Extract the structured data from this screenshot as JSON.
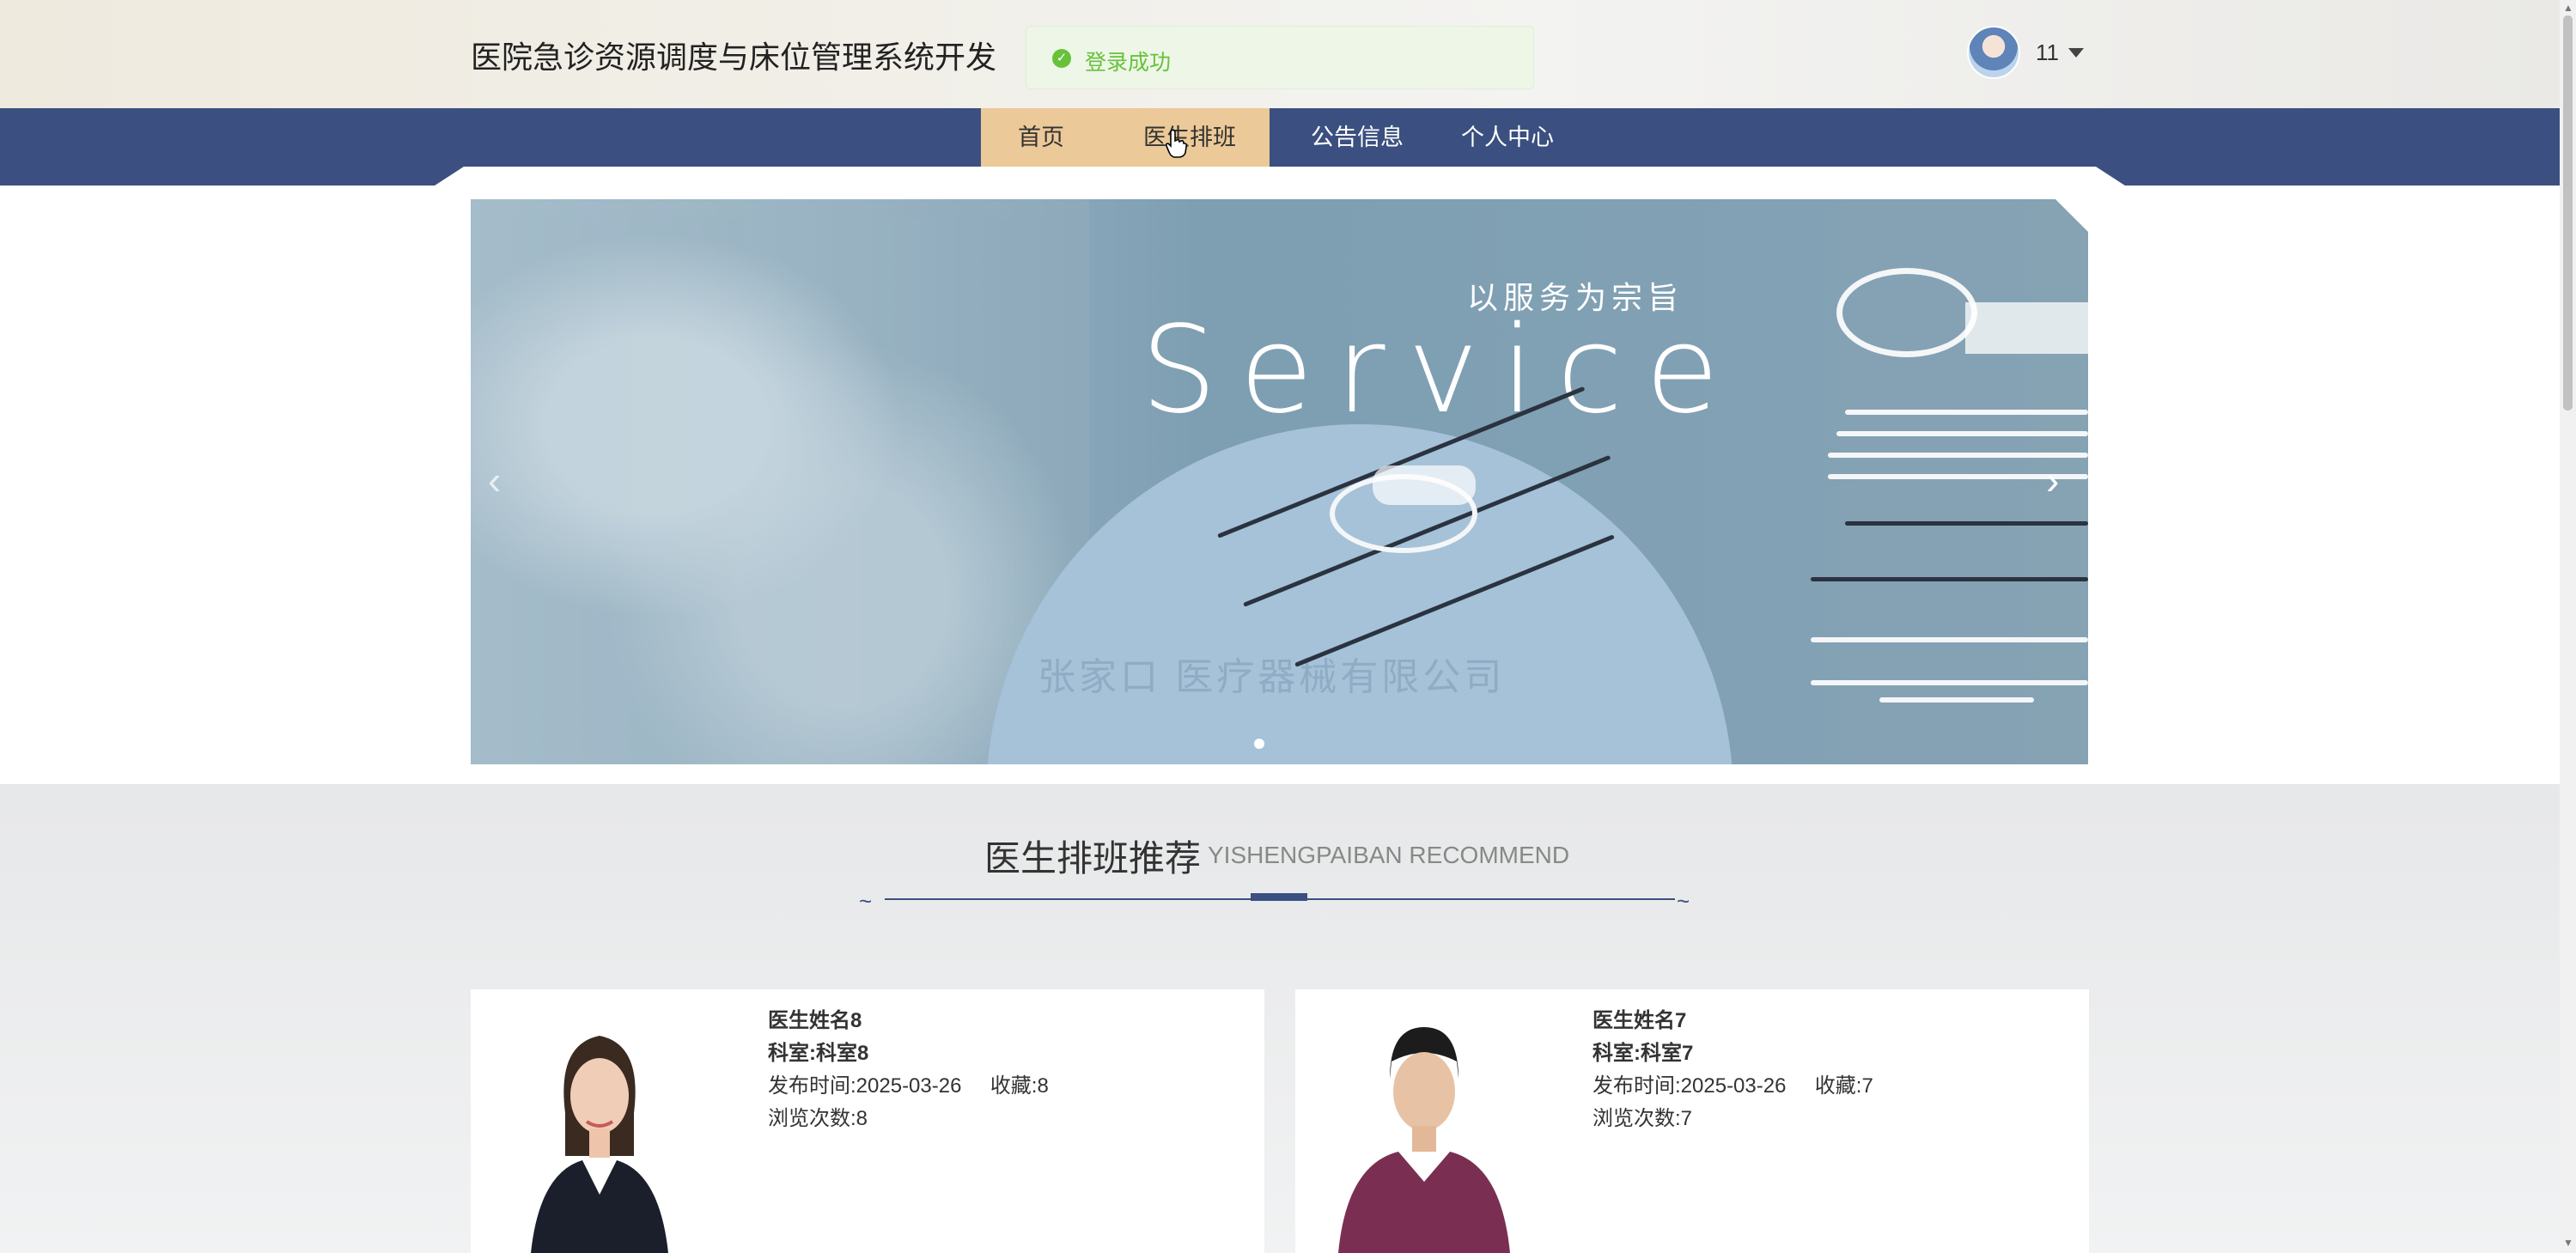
{
  "header": {
    "site_title": "医院急诊资源调度与床位管理系统开发",
    "toast": {
      "icon": "check-circle-icon",
      "text": "登录成功",
      "color": "#67c23a"
    },
    "user": {
      "name": "11"
    }
  },
  "nav": {
    "items": [
      {
        "label": "首页"
      },
      {
        "label": "医生排班"
      },
      {
        "label": "公告信息"
      },
      {
        "label": "个人中心"
      }
    ],
    "active_color": "#ecc998",
    "bar_color": "#3b5080"
  },
  "banner": {
    "slogan": "以服务为宗旨",
    "headline": "Service",
    "watermark": "张家口 医疗器械有限公司",
    "prev_icon": "chevron-left-icon",
    "next_icon": "chevron-right-icon"
  },
  "section": {
    "title_cn": "医生排班推荐",
    "title_en": "YISHENGPAIBAN RECOMMEND"
  },
  "cards": [
    {
      "name": "医生姓名8",
      "dept": "科室:科室8",
      "publish_label": "发布时间:",
      "publish_date": "2025-03-26",
      "fav_label": "收藏:",
      "fav_count": "8",
      "views_label": "浏览次数:",
      "views": "8"
    },
    {
      "name": "医生姓名7",
      "dept": "科室:科室7",
      "publish_label": "发布时间:",
      "publish_date": "2025-03-26",
      "fav_label": "收藏:",
      "fav_count": "7",
      "views_label": "浏览次数:",
      "views": "7"
    }
  ]
}
